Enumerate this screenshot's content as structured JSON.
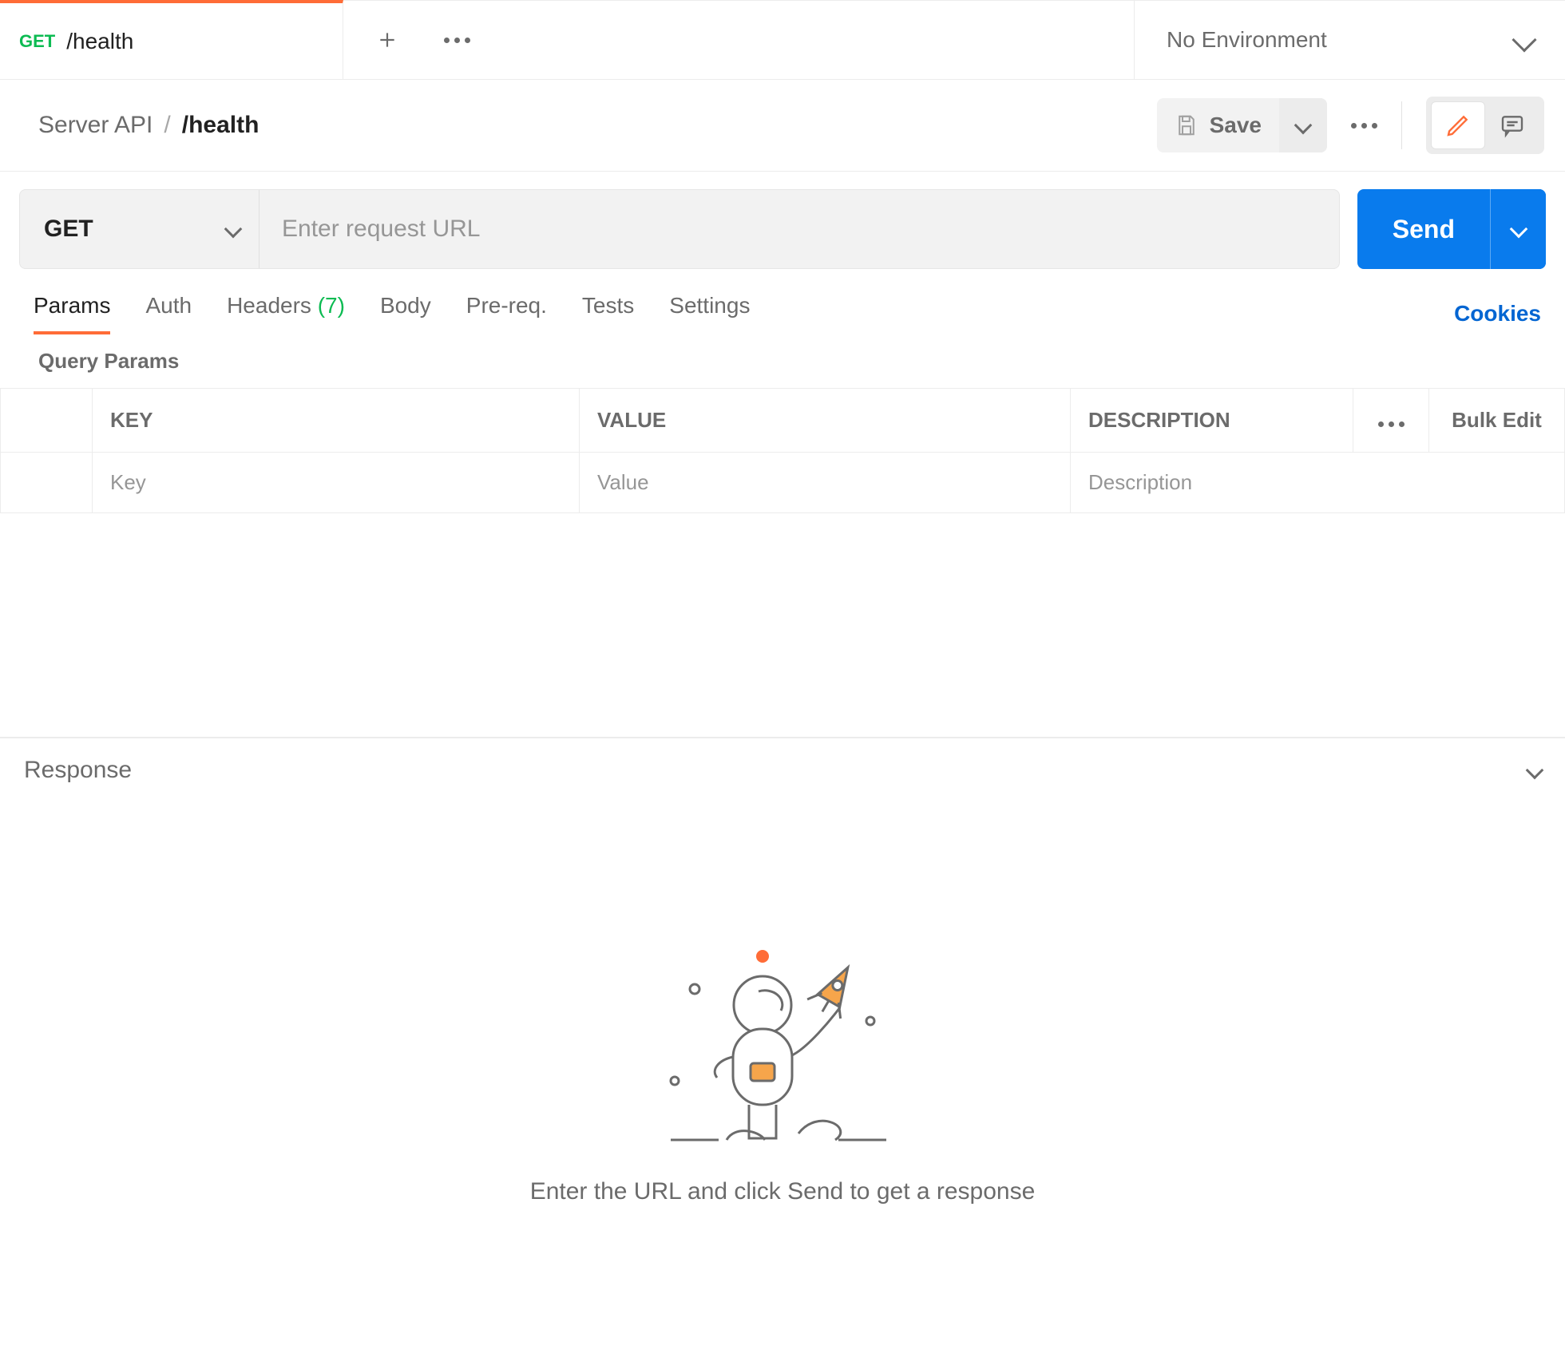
{
  "tab": {
    "method": "GET",
    "name": "/health"
  },
  "environment": {
    "label": "No Environment"
  },
  "breadcrumb": {
    "collection": "Server API",
    "request": "/health",
    "separator": "/"
  },
  "save": {
    "label": "Save"
  },
  "url": {
    "method": "GET",
    "placeholder": "Enter request URL",
    "value": ""
  },
  "send": {
    "label": "Send"
  },
  "reqtabs": {
    "params": "Params",
    "auth": "Auth",
    "headers": "Headers",
    "headers_count": "(7)",
    "body": "Body",
    "prereq": "Pre-req.",
    "tests": "Tests",
    "settings": "Settings",
    "cookies": "Cookies"
  },
  "querysection": {
    "title": "Query Params"
  },
  "qheaders": {
    "key": "KEY",
    "value": "VALUE",
    "description": "DESCRIPTION",
    "bulk": "Bulk Edit"
  },
  "qplaceholders": {
    "key": "Key",
    "value": "Value",
    "description": "Description"
  },
  "response": {
    "title": "Response",
    "empty_msg": "Enter the URL and click Send to get a response"
  }
}
